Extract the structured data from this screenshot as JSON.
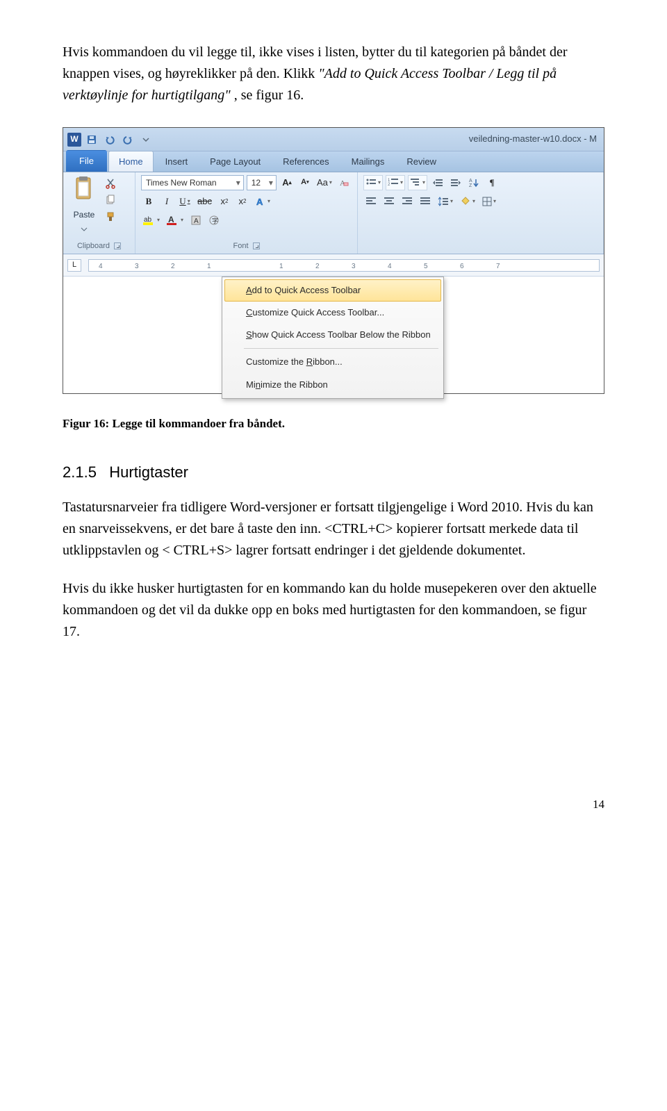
{
  "para1_a": "Hvis kommandoen du vil legge til, ikke vises i listen, bytter du til kategorien på båndet der knappen vises, og høyreklikker på den. Klikk ",
  "para1_b": "\"Add to Quick Access Toolbar / Legg til på verktøylinje for hurtigtilgang\"",
  "para1_c": ", se figur 16.",
  "caption": "Figur 16: Legge til kommandoer fra båndet.",
  "h3_num": "2.1.5",
  "h3_txt": "Hurtigtaster",
  "para2": "Tastatursnarveier fra tidligere Word-versjoner er fortsatt tilgjengelige i Word 2010. Hvis du kan en snarveissekvens, er det bare å taste den inn. <CTRL+C> kopierer fortsatt merkede data til utklippstavlen og < CTRL+S> lagrer fortsatt endringer i det gjeldende dokumentet.",
  "para3": "Hvis du ikke husker hurtigtasten for en kommando kan du holde musepekeren over den aktuelle kommandoen og det vil da dukke opp en boks med hurtigtasten for den kommandoen, se figur 17.",
  "page_num": "14",
  "screenshot": {
    "word_icon": "W",
    "doc_title": "veiledning-master-w10.docx - M",
    "tabs": {
      "file": "File",
      "home": "Home",
      "insert": "Insert",
      "page_layout": "Page Layout",
      "references": "References",
      "mailings": "Mailings",
      "review": "Review"
    },
    "clipboard": {
      "paste": "Paste",
      "label": "Clipboard"
    },
    "font": {
      "name": "Times New Roman",
      "size": "12",
      "label": "Font"
    },
    "ruler_left": "L",
    "ruler_marks": [
      "4",
      "3",
      "2",
      "1",
      "1",
      "2",
      "3",
      "4",
      "5",
      "6",
      "7"
    ],
    "context_menu": {
      "add": "Add to Quick Access Toolbar",
      "customize_qat": "Customize Quick Access Toolbar...",
      "show_below": "Show Quick Access Toolbar Below the Ribbon",
      "customize_ribbon": "Customize the Ribbon...",
      "minimize": "Minimize the Ribbon"
    }
  }
}
